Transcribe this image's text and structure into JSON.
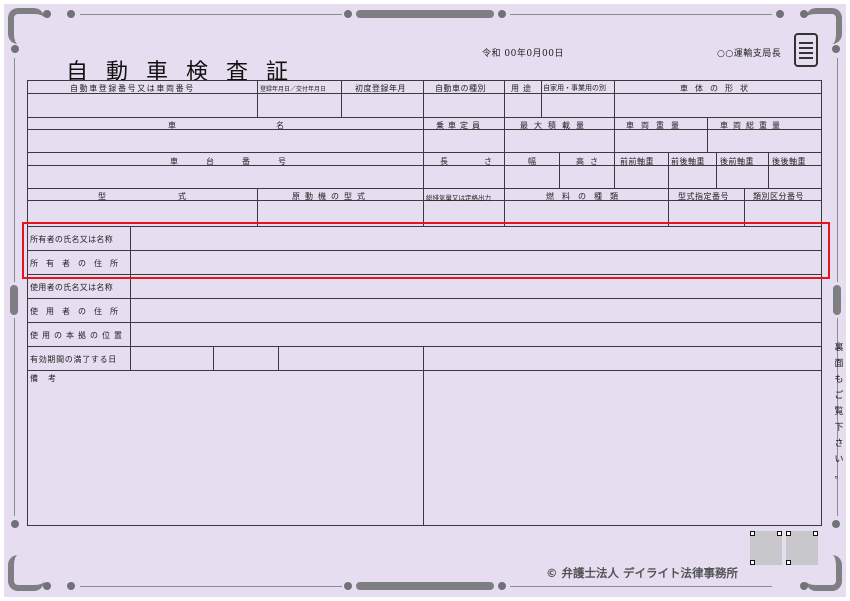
{
  "header": {
    "title": "自動車検査証",
    "date": "令和 00年0月00日",
    "office": "○○運輸支局長"
  },
  "labels": {
    "reg_no": "自動車登録番号又は車両番号",
    "reg_date": "登録年月日／交付年月日",
    "first_reg": "初度登録年月",
    "car_type": "自動車の種別",
    "usage": "用途",
    "private_business": "自家用・事業用の別",
    "body_shape": "車体の形状",
    "car_name": "車名",
    "capacity": "乗車定員",
    "max_load": "最大積載量",
    "weight": "車両重量",
    "gross_weight": "車両総重量",
    "chassis_no": "車台番号",
    "length": "長さ",
    "width": "幅",
    "height": "高さ",
    "ff_axle": "前前軸重",
    "fr_axle": "前後軸重",
    "rf_axle": "後前軸重",
    "rr_axle": "後後軸重",
    "model": "型式",
    "engine_model": "原動機の型式",
    "displacement": "総排気量又は定格出力",
    "fuel": "燃料の種類",
    "model_designation_no": "型式指定番号",
    "category_no": "類別区分番号",
    "owner_name": "所有者の氏名又は名称",
    "owner_address": "所有者の住所",
    "user_name": "使用者の氏名又は名称",
    "user_address": "使用者の住所",
    "base_location": "使用の本拠の位置",
    "expiry": "有効期間の満了する日",
    "remarks": "備考"
  },
  "side_note": "裏面もご覧下さい。",
  "copyright": "© 弁護士法人 デイライト法律事務所",
  "colors": {
    "paper": "#e6def0",
    "rule": "#3a3a3a",
    "frame": "#7d7f83",
    "highlight": "#e8141b"
  },
  "highlight": {
    "target": "owner_rows"
  }
}
